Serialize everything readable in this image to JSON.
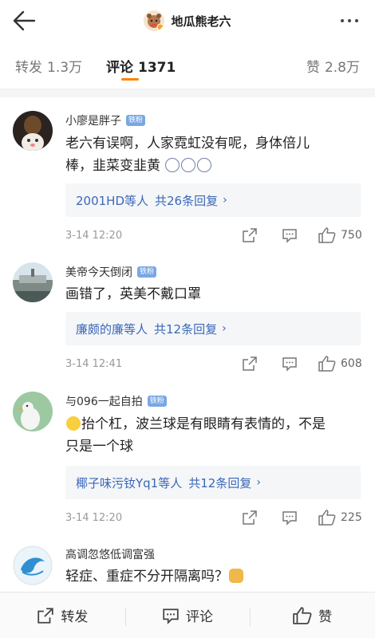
{
  "header": {
    "title": "地瓜熊老六",
    "back_icon": "back-arrow-icon",
    "more_icon": "more-dots-icon"
  },
  "tabs": {
    "repost": {
      "label": "转发",
      "count": "1.3万"
    },
    "comment": {
      "label": "评论",
      "count": "1371"
    },
    "like": {
      "label": "赞",
      "count": "2.8万"
    },
    "accent": "#ff8200"
  },
  "comments": [
    {
      "user": "小廖是胖子",
      "badge": "铁粉",
      "text_line1": "老六有误啊，人家霓虹没有呢，身体倍儿",
      "text_line2": "棒，韭菜变韭黄",
      "replies_names": "2001HD等人",
      "replies_count": "共26条回复",
      "time": "3-14 12:20",
      "likes": "750"
    },
    {
      "user": "美帝今天倒闭",
      "badge": "铁粉",
      "text_line1": "画错了，英美不戴口罩",
      "replies_names": "廉颇的廉等人",
      "replies_count": "共12条回复",
      "time": "3-14 12:41",
      "likes": "608"
    },
    {
      "user": "与096一起自拍",
      "badge": "铁粉",
      "text_line1": "抬个杠，波兰球是有眼睛有表情的，不是",
      "text_line2": "只是一个球",
      "replies_names": "椰子味污钕Yq1等人",
      "replies_count": "共12条回复",
      "time": "3-14 12:20",
      "likes": "225"
    },
    {
      "user": "高调忽悠低调富强",
      "text_line1": "轻症、重症不分开隔离吗？"
    }
  ],
  "bottom_bar": {
    "repost_label": "转发",
    "comment_label": "评论",
    "like_label": "赞"
  },
  "colors": {
    "link_blue": "#3a68b8",
    "badge_blue": "#7aa7e3",
    "bg_gray": "#f5f5f5"
  }
}
